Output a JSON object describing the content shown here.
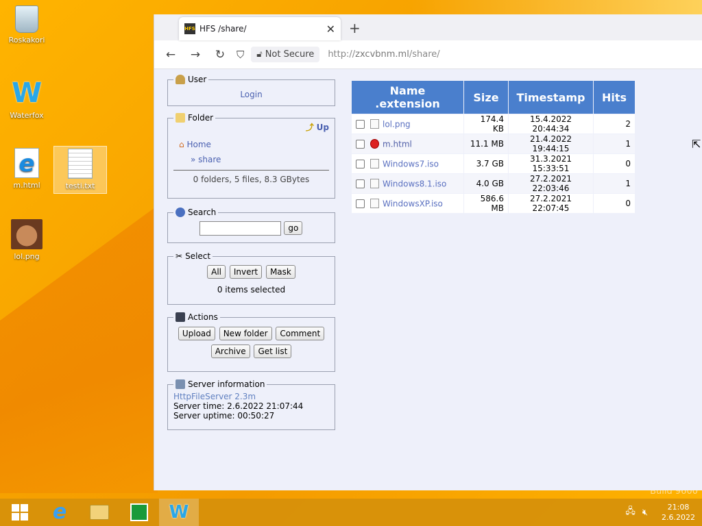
{
  "desktop": {
    "icons": [
      {
        "label": "Roskakori"
      },
      {
        "label": "Waterfox"
      },
      {
        "label": "m.html"
      },
      {
        "label": "testi.txt"
      },
      {
        "label": "lol.png"
      }
    ],
    "watermark": "Build 9600"
  },
  "browser": {
    "tab_title": "HFS /share/",
    "tab_favicon": "HFS",
    "security_label": "Not Secure",
    "url_scheme": "http://",
    "url_host": "zxcvbnm.ml",
    "url_path": "/share/"
  },
  "sidebar": {
    "user": {
      "legend": "User",
      "login": "Login"
    },
    "folder": {
      "legend": "Folder",
      "up": "Up",
      "home": "Home",
      "share": "» share",
      "summary": "0 folders, 5 files, 8.3 GBytes"
    },
    "search": {
      "legend": "Search",
      "value": "",
      "go": "go"
    },
    "select": {
      "legend": "Select",
      "all": "All",
      "invert": "Invert",
      "mask": "Mask",
      "status": "0 items selected"
    },
    "actions": {
      "legend": "Actions",
      "upload": "Upload",
      "new_folder": "New folder",
      "comment": "Comment",
      "archive": "Archive",
      "get_list": "Get list"
    },
    "server": {
      "legend": "Server information",
      "software": "HttpFileServer 2.3m",
      "time": "Server time: 2.6.2022 21:07:44",
      "uptime": "Server uptime: 00:50:27"
    }
  },
  "table": {
    "headers": [
      "Name .extension",
      "Size",
      "Timestamp",
      "Hits"
    ],
    "rows": [
      {
        "name": "lol.png",
        "size": "174.4 KB",
        "timestamp": "15.4.2022 20:44:34",
        "hits": "2"
      },
      {
        "name": "m.html",
        "size": "11.1 MB",
        "timestamp": "21.4.2022 19:44:15",
        "hits": "1"
      },
      {
        "name": "Windows7.iso",
        "size": "3.7 GB",
        "timestamp": "31.3.2021 15:33:51",
        "hits": "0"
      },
      {
        "name": "Windows8.1.iso",
        "size": "4.0 GB",
        "timestamp": "27.2.2021 22:03:46",
        "hits": "1"
      },
      {
        "name": "WindowsXP.iso",
        "size": "586.6 MB",
        "timestamp": "27.2.2021 22:07:45",
        "hits": "0"
      }
    ]
  },
  "taskbar": {
    "time": "21:08",
    "date": "2.6.2022"
  },
  "colors": {
    "table_header": "#4a7fcd",
    "link": "#4a60b0",
    "desktop": "#f7a300"
  }
}
